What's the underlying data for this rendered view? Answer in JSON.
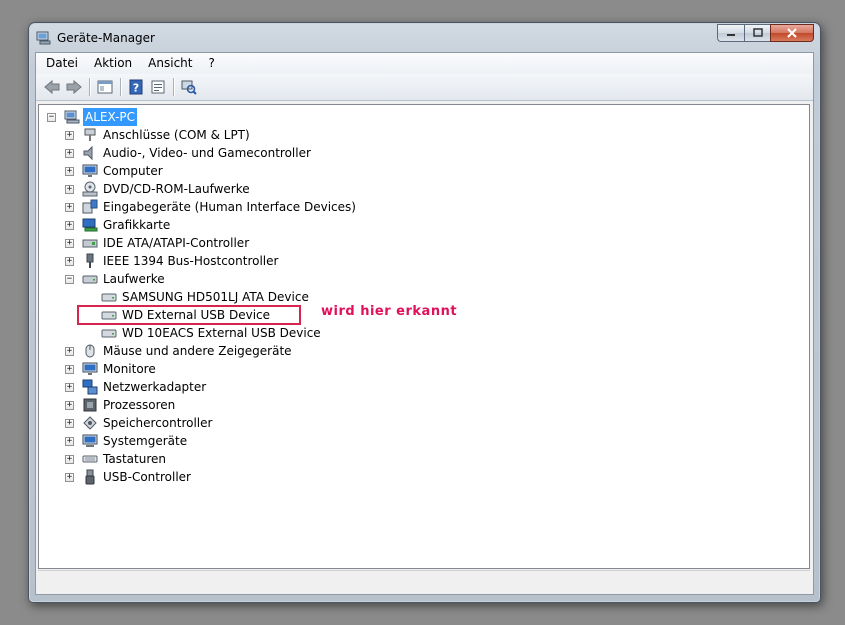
{
  "window": {
    "title": "Geräte-Manager",
    "caption_buttons": {
      "minimize": "▁",
      "maximize": "▢",
      "close": "✕"
    }
  },
  "menubar": {
    "items": [
      "Datei",
      "Aktion",
      "Ansicht",
      "?"
    ]
  },
  "toolbar": {
    "buttons": [
      "back-icon",
      "forward-icon",
      "show-hide-console-tree-icon",
      "help-icon",
      "properties-icon",
      "scan-hardware-icon"
    ]
  },
  "tree": {
    "root": {
      "label": "ALEX-PC",
      "expander": "−",
      "icon": "computer-icon"
    },
    "categories": [
      {
        "label": "Anschlüsse (COM & LPT)",
        "expander": "+",
        "icon": "port-icon"
      },
      {
        "label": "Audio-, Video- und Gamecontroller",
        "expander": "+",
        "icon": "speaker-icon"
      },
      {
        "label": "Computer",
        "expander": "+",
        "icon": "monitor-icon"
      },
      {
        "label": "DVD/CD-ROM-Laufwerke",
        "expander": "+",
        "icon": "disc-drive-icon"
      },
      {
        "label": "Eingabegeräte (Human Interface Devices)",
        "expander": "+",
        "icon": "hid-icon"
      },
      {
        "label": "Grafikkarte",
        "expander": "+",
        "icon": "display-adapter-icon"
      },
      {
        "label": "IDE ATA/ATAPI-Controller",
        "expander": "+",
        "icon": "ide-controller-icon"
      },
      {
        "label": "IEEE 1394 Bus-Hostcontroller",
        "expander": "+",
        "icon": "firewire-icon"
      },
      {
        "label": "Laufwerke",
        "expander": "−",
        "icon": "drive-icon"
      },
      {
        "label": "Mäuse und andere Zeigegeräte",
        "expander": "+",
        "icon": "mouse-icon"
      },
      {
        "label": "Monitore",
        "expander": "+",
        "icon": "monitor-icon"
      },
      {
        "label": "Netzwerkadapter",
        "expander": "+",
        "icon": "network-icon"
      },
      {
        "label": "Prozessoren",
        "expander": "+",
        "icon": "cpu-icon"
      },
      {
        "label": "Speichercontroller",
        "expander": "+",
        "icon": "storage-controller-icon"
      },
      {
        "label": "Systemgeräte",
        "expander": "+",
        "icon": "system-device-icon"
      },
      {
        "label": "Tastaturen",
        "expander": "+",
        "icon": "keyboard-icon"
      },
      {
        "label": "USB-Controller",
        "expander": "+",
        "icon": "usb-icon"
      }
    ],
    "drives": [
      {
        "label": "SAMSUNG HD501LJ ATA Device",
        "icon": "hard-drive-icon"
      },
      {
        "label": "WD  External USB Device",
        "icon": "hard-drive-icon"
      },
      {
        "label": "WD 10EACS External USB Device",
        "icon": "hard-drive-icon"
      }
    ]
  },
  "annotation": {
    "text": "wird hier erkannt",
    "color": "#e0105a"
  },
  "colors": {
    "selection": "#3399ff",
    "annotation_box": "#d8244e"
  }
}
